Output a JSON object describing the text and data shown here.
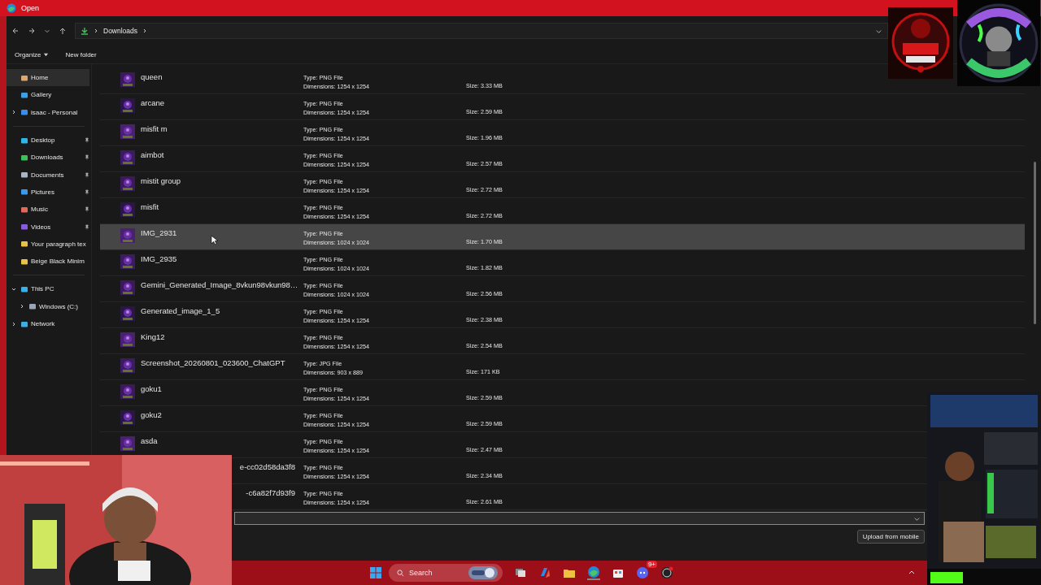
{
  "window": {
    "title": "Open"
  },
  "address_bar": {
    "path": [
      "Downloads"
    ]
  },
  "toolbar": {
    "organize": "Organize",
    "new_folder": "New folder"
  },
  "sidebar": {
    "groups": [
      [
        {
          "label": "Home",
          "selected": true,
          "pinned": false
        },
        {
          "label": "Gallery",
          "selected": false,
          "pinned": false
        },
        {
          "label": "isaac - Personal",
          "selected": false,
          "pinned": false,
          "expanded": false
        }
      ],
      [
        {
          "label": "Desktop",
          "selected": false,
          "pinned": true
        },
        {
          "label": "Downloads",
          "selected": false,
          "pinned": true
        },
        {
          "label": "Documents",
          "selected": false,
          "pinned": true
        },
        {
          "label": "Pictures",
          "selected": false,
          "pinned": true
        },
        {
          "label": "Music",
          "selected": false,
          "pinned": true
        },
        {
          "label": "Videos",
          "selected": false,
          "pinned": true
        },
        {
          "label": "Your paragraph tex",
          "selected": false,
          "pinned": false
        },
        {
          "label": "Beige Black Minim",
          "selected": false,
          "pinned": false
        }
      ],
      [
        {
          "label": "This PC",
          "selected": false,
          "pinned": false,
          "expanded": true,
          "children": [
            {
              "label": "Windows (C:)",
              "selected": false,
              "pinned": false,
              "expanded": false
            }
          ]
        },
        {
          "label": "Network",
          "selected": false,
          "pinned": false,
          "expanded": false
        }
      ]
    ]
  },
  "files": [
    {
      "kind": "file",
      "name": "queen",
      "type": "Type: PNG File",
      "dimensions": "Dimensions: 1254 x 1254",
      "size": "Size: 3.33 MB",
      "selected": false
    },
    {
      "kind": "file",
      "name": "arcane",
      "type": "Type: PNG File",
      "dimensions": "Dimensions: 1254 x 1254",
      "size": "Size: 2.59 MB",
      "selected": false
    },
    {
      "kind": "file",
      "name": "misfit m",
      "type": "Type: PNG File",
      "dimensions": "Dimensions: 1254 x 1254",
      "size": "Size: 1.96 MB",
      "selected": false
    },
    {
      "kind": "file",
      "name": "aimbot",
      "type": "Type: PNG File",
      "dimensions": "Dimensions: 1254 x 1254",
      "size": "Size: 2.57 MB",
      "selected": false
    },
    {
      "kind": "file",
      "name": "mistit group",
      "type": "Type: PNG File",
      "dimensions": "Dimensions: 1254 x 1254",
      "size": "Size: 2.72 MB",
      "selected": false
    },
    {
      "kind": "file",
      "name": "misfit",
      "type": "Type: PNG File",
      "dimensions": "Dimensions: 1254 x 1254",
      "size": "Size: 2.72 MB",
      "selected": false
    },
    {
      "kind": "file",
      "name": "IMG_2931",
      "type": "Type: PNG File",
      "dimensions": "Dimensions: 1024 x 1024",
      "size": "Size: 1.70 MB",
      "selected": true
    },
    {
      "kind": "file",
      "name": "IMG_2935",
      "type": "Type: PNG File",
      "dimensions": "Dimensions: 1024 x 1024",
      "size": "Size: 1.82 MB",
      "selected": false
    },
    {
      "kind": "file",
      "name": "Gemini_Generated_Image_8vkun98vkun98…",
      "type": "Type: PNG File",
      "dimensions": "Dimensions: 1024 x 1024",
      "size": "Size: 2.56 MB",
      "selected": false
    },
    {
      "kind": "file",
      "name": "Generated_image_1_5",
      "type": "Type: PNG File",
      "dimensions": "Dimensions: 1254 x 1254",
      "size": "Size: 2.38 MB",
      "selected": false
    },
    {
      "kind": "file",
      "name": "King12",
      "type": "Type: PNG File",
      "dimensions": "Dimensions: 1254 x 1254",
      "size": "Size: 2.54 MB",
      "selected": false
    },
    {
      "kind": "file",
      "name": "Screenshot_20260801_023600_ChatGPT",
      "type": "Type: JPG File",
      "dimensions": "Dimensions: 903 x 889",
      "size": "Size: 171 KB",
      "selected": false
    },
    {
      "kind": "file",
      "name": "goku1",
      "type": "Type: PNG File",
      "dimensions": "Dimensions: 1254 x 1254",
      "size": "Size: 2.59 MB",
      "selected": false
    },
    {
      "kind": "file",
      "name": "goku2",
      "type": "Type: PNG File",
      "dimensions": "Dimensions: 1254 x 1254",
      "size": "Size: 2.59 MB",
      "selected": false
    },
    {
      "kind": "file",
      "name": "asda",
      "type": "Type: PNG File",
      "dimensions": "Dimensions: 1254 x 1254",
      "size": "Size: 2.47 MB",
      "selected": false
    },
    {
      "kind": "partial",
      "name": "e-cc02d58da3f8",
      "type": "Type: PNG File",
      "dimensions": "Dimensions: 1254 x 1254",
      "size": "Size: 2.34 MB",
      "selected": false
    },
    {
      "kind": "partial",
      "name": "-c6a82f7d93f9",
      "type": "Type: PNG File",
      "dimensions": "Dimensions: 1254 x 1254",
      "size": "Size: 2.61 MB",
      "selected": false
    }
  ],
  "bottom": {
    "upload_button": "Upload from mobile"
  },
  "taskbar": {
    "search_placeholder": "Search",
    "chat_badge": "9+"
  }
}
